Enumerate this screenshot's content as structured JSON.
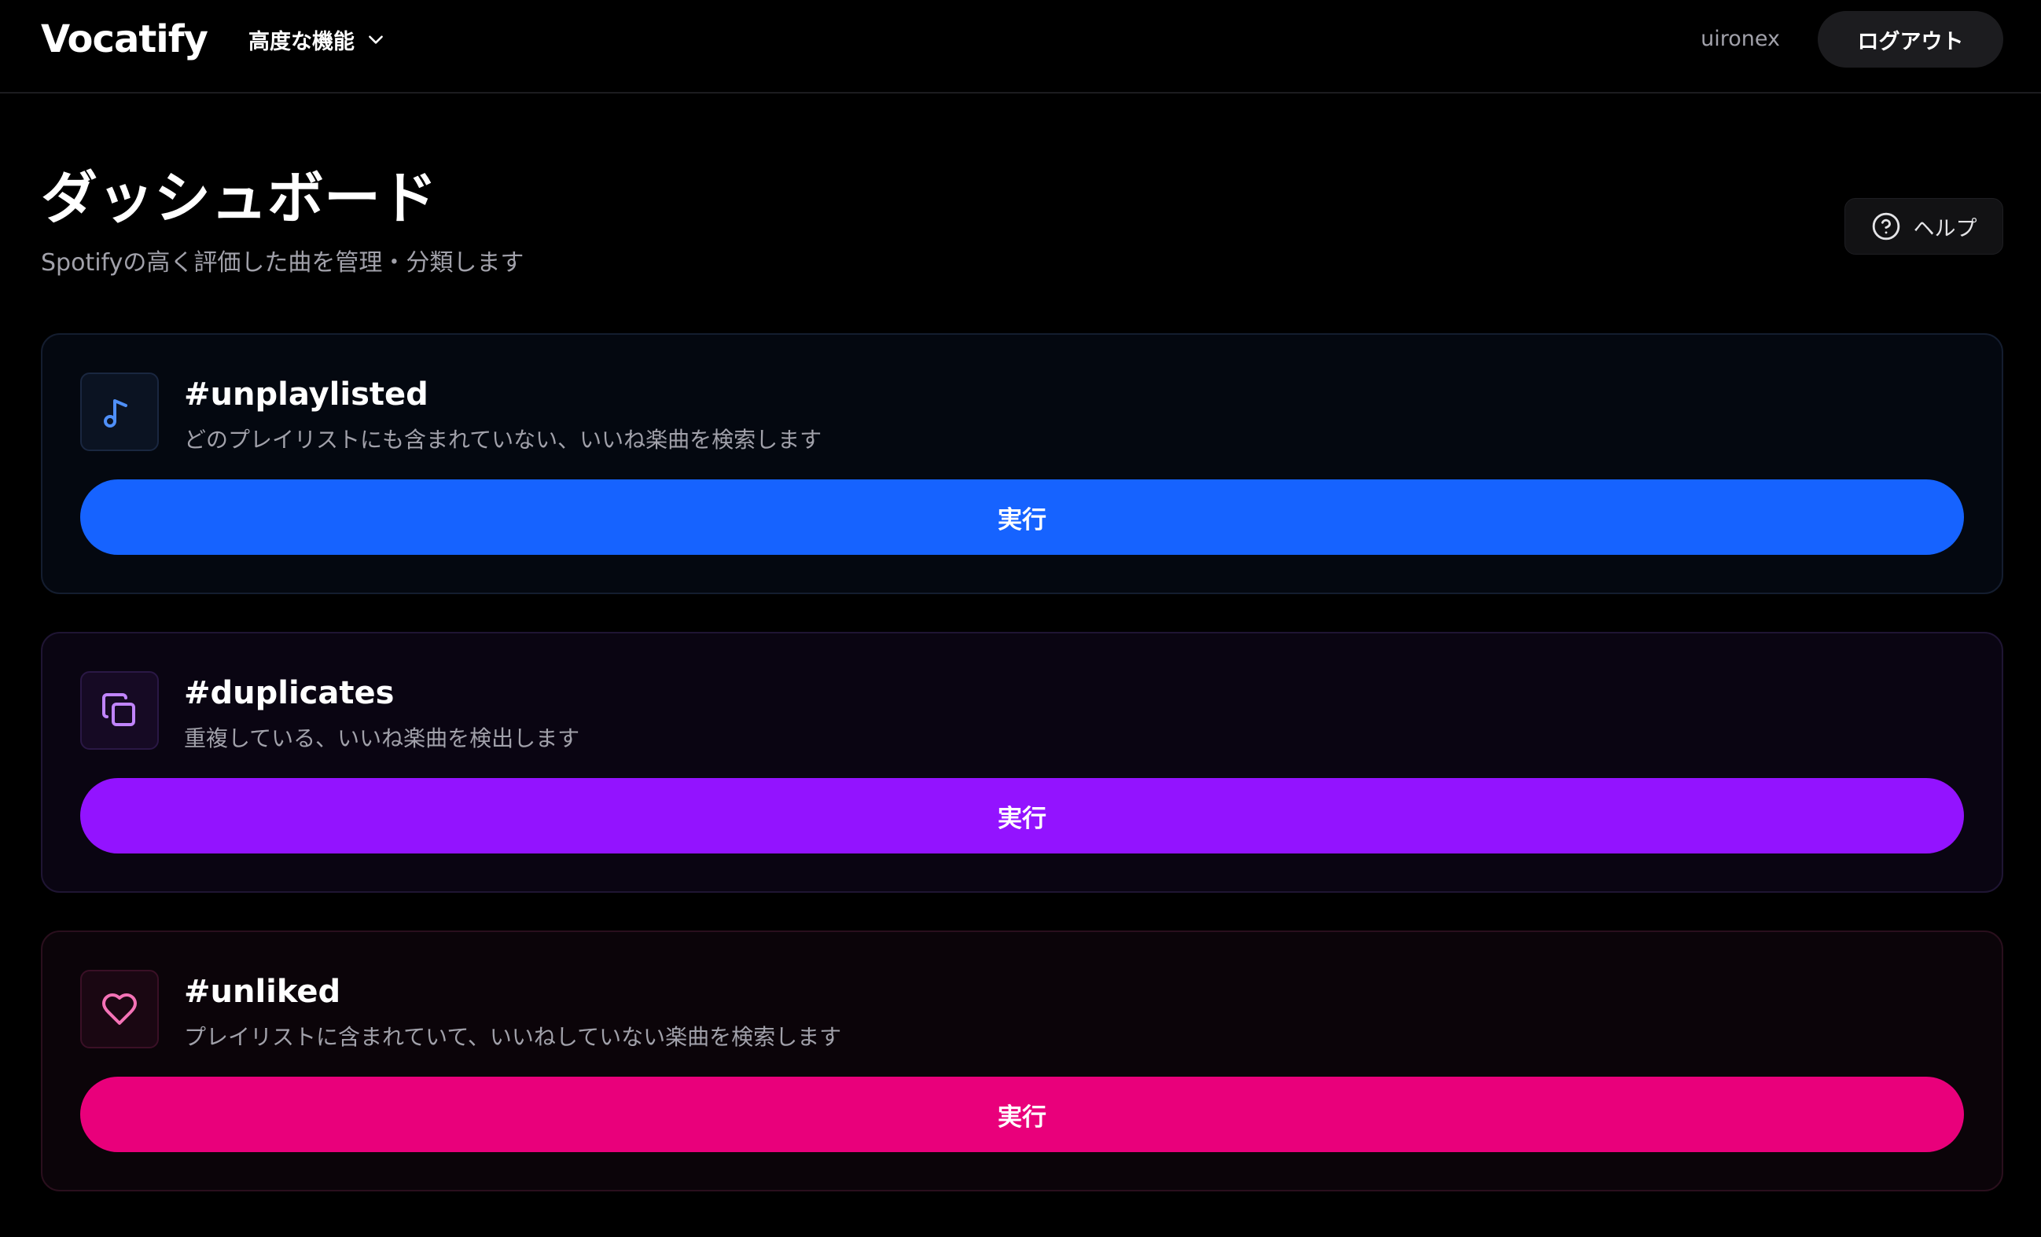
{
  "header": {
    "logo": "Vocatify",
    "advanced_menu_label": "高度な機能",
    "username": "uironex",
    "logout_label": "ログアウト"
  },
  "page": {
    "title": "ダッシュボード",
    "subtitle": "Spotifyの高く評価した曲を管理・分類します",
    "help_label": "ヘルプ"
  },
  "cards": [
    {
      "title": "#unplaylisted",
      "description": "どのプレイリストにも含まれていない、いいね楽曲を検索します",
      "button_label": "実行",
      "icon": "music-note-icon",
      "accent": "#1663ff",
      "icon_color": "#4f8ff7"
    },
    {
      "title": "#duplicates",
      "description": "重複している、いいね楽曲を検出します",
      "button_label": "実行",
      "icon": "copy-icon",
      "accent": "#9313ff",
      "icon_color": "#c084fc"
    },
    {
      "title": "#unliked",
      "description": "プレイリストに含まれていて、いいねしていない楽曲を検索します",
      "button_label": "実行",
      "icon": "heart-icon",
      "accent": "#e9007b",
      "icon_color": "#f472b6"
    }
  ]
}
